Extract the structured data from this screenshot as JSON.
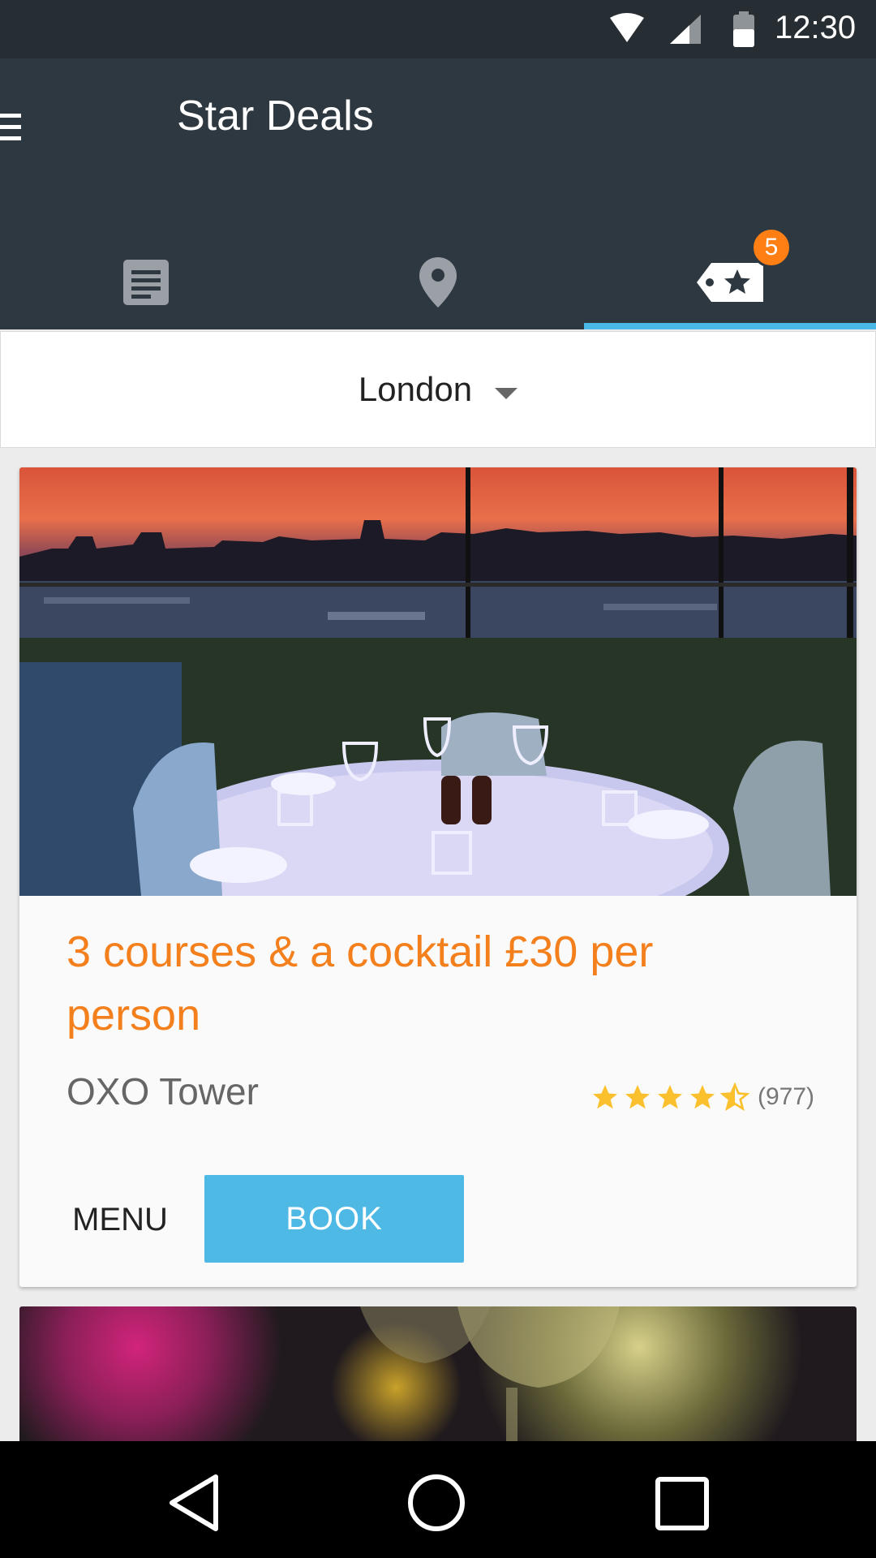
{
  "status_bar": {
    "time": "12:30",
    "icons": [
      "wifi-icon",
      "cell-signal-icon",
      "battery-icon"
    ]
  },
  "app_bar": {
    "title": "Star Deals",
    "menu_icon": "hamburger-menu-icon",
    "tabs": [
      {
        "name": "news",
        "icon": "article-icon",
        "selected": false
      },
      {
        "name": "map",
        "icon": "location-pin-icon",
        "selected": false
      },
      {
        "name": "deals",
        "icon": "star-tag-icon",
        "selected": true,
        "badge": "5"
      }
    ]
  },
  "location": {
    "label": "London",
    "icon": "dropdown-arrow-icon"
  },
  "deal": {
    "title": "3 courses & a cocktail £30 per person",
    "venue": "OXO Tower",
    "rating": 4.5,
    "review_count": "(977)",
    "menu_label": "MENU",
    "book_label": "BOOK"
  },
  "nav_bar": {
    "icons": [
      "back-icon",
      "home-icon",
      "recents-icon"
    ]
  },
  "colors": {
    "status_bar": "#262d33",
    "app_bar": "#2e3840",
    "accent_blue": "#4fb9e5",
    "title_orange": "#f47f1d",
    "badge_orange": "#ff7f15",
    "star_yellow": "#fbc02d"
  }
}
